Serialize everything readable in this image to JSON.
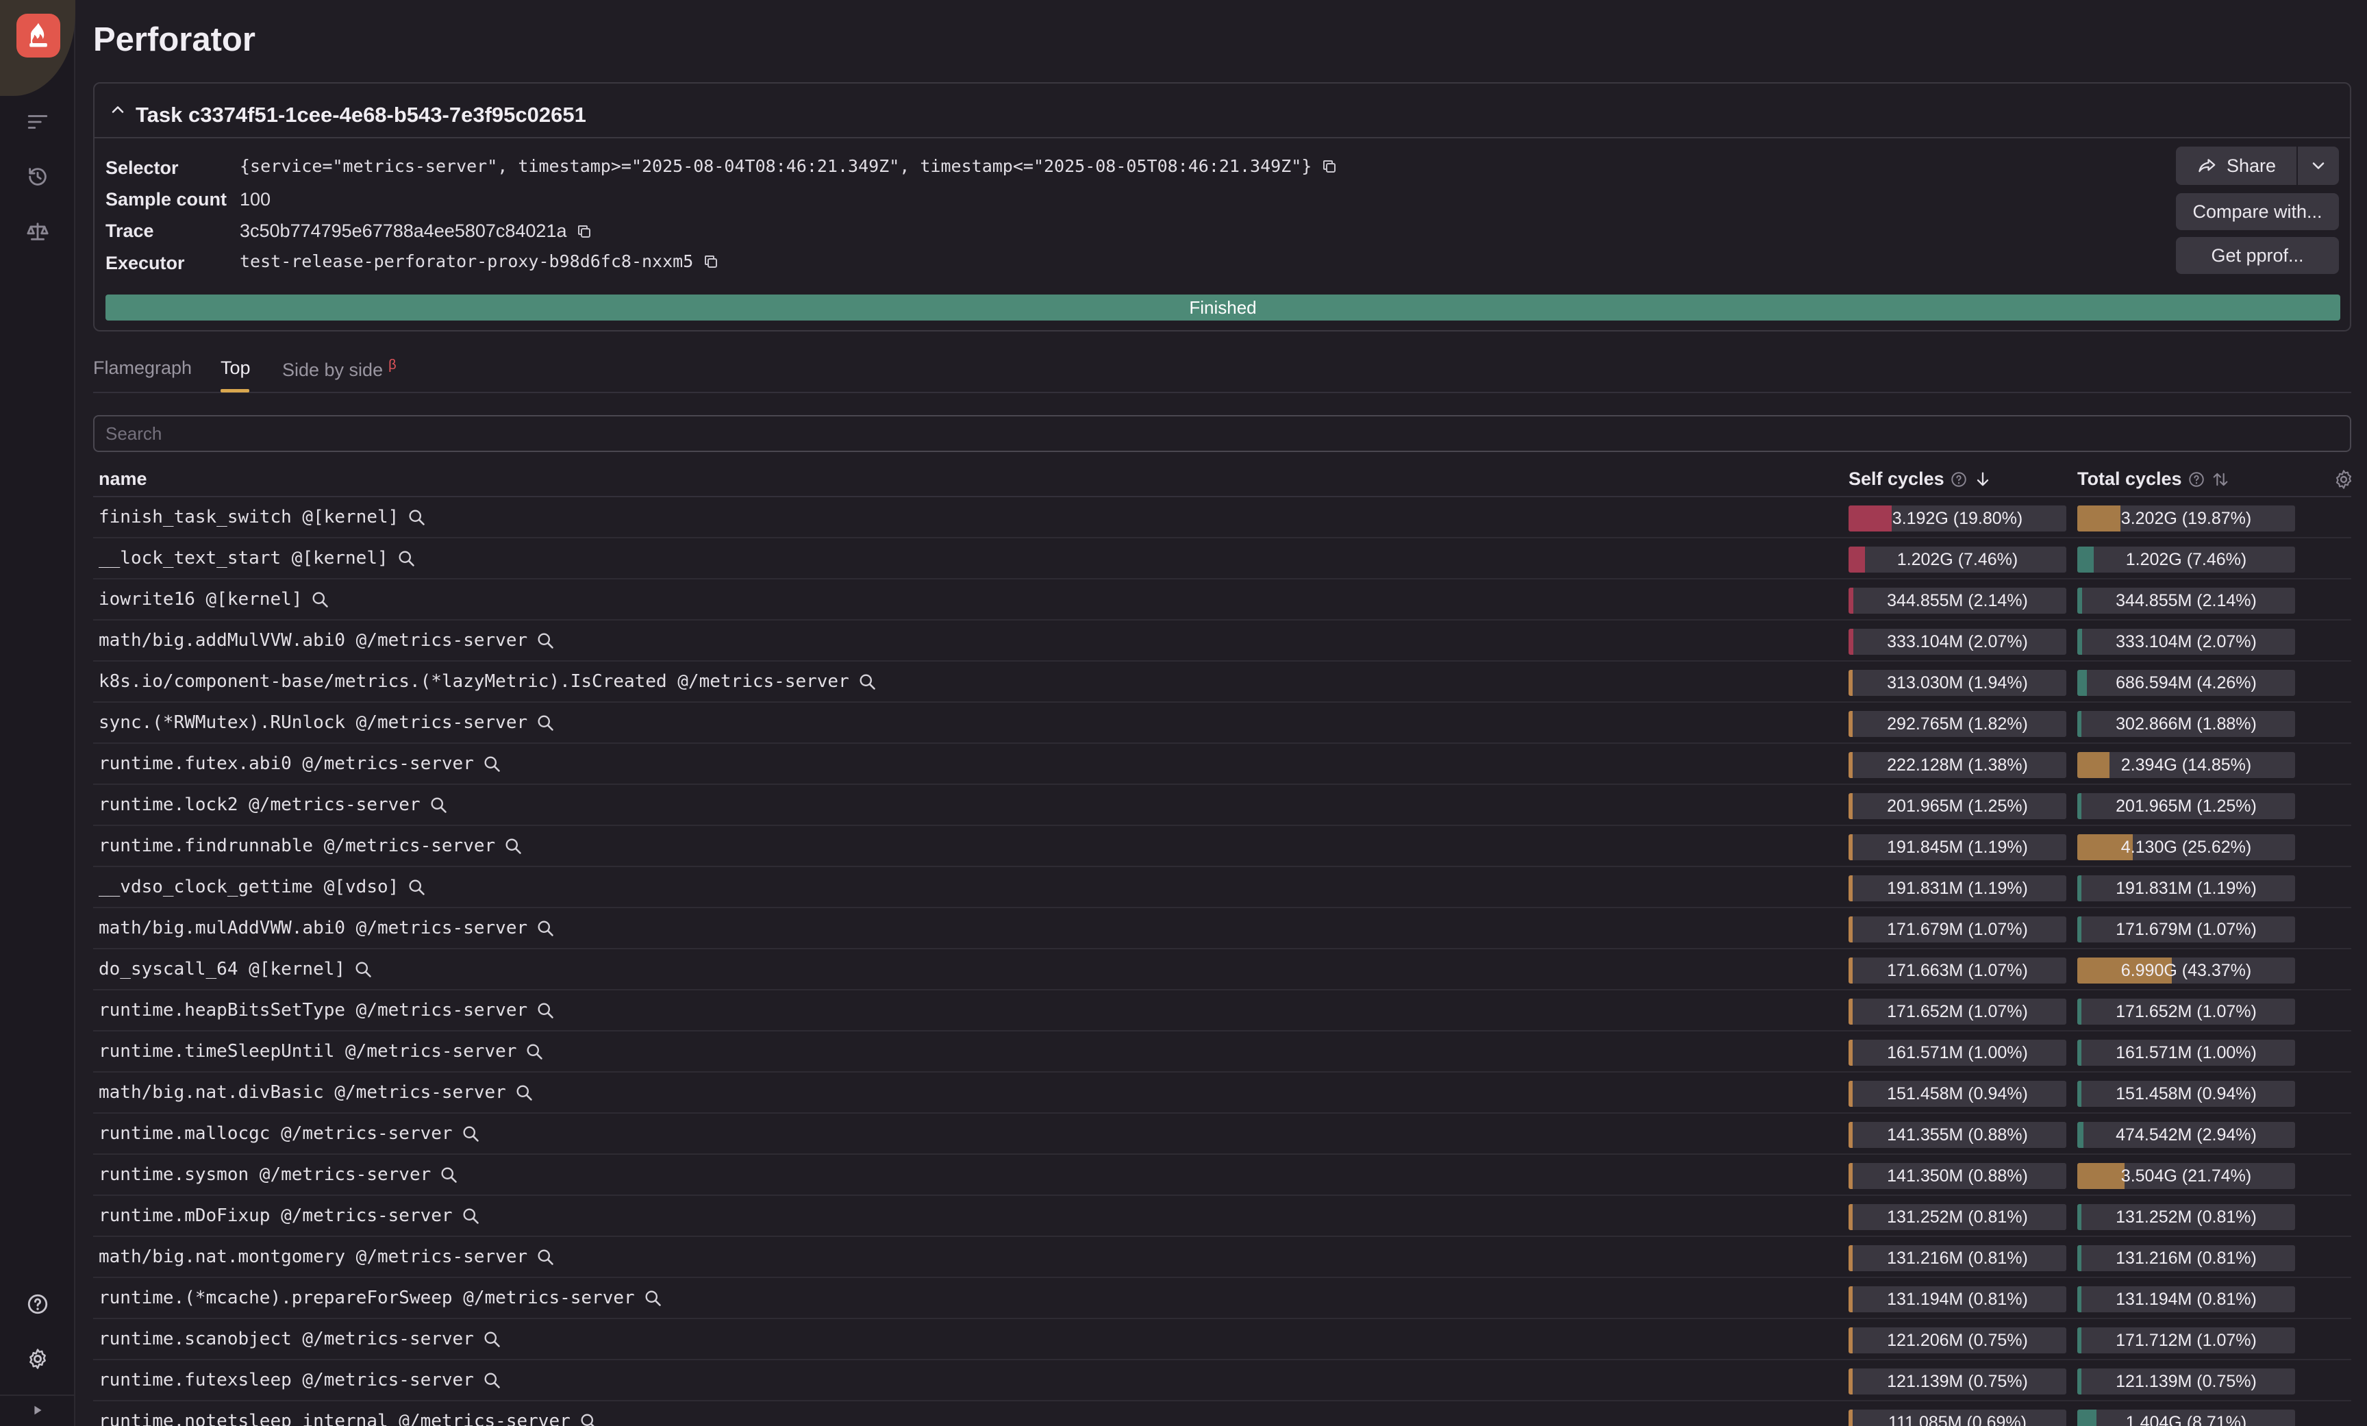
{
  "app": {
    "title": "Perforator"
  },
  "sidebar": {
    "icons": [
      "flame-logo-icon",
      "list-icon",
      "history-icon",
      "balance-icon",
      "help-icon",
      "settings-icon",
      "expand-icon"
    ]
  },
  "task": {
    "title": "Task c3374f51-1cee-4e68-b543-7e3f95c02651",
    "selector_label": "Selector",
    "selector_value": "{service=\"metrics-server\", timestamp>=\"2025-08-04T08:46:21.349Z\", timestamp<=\"2025-08-05T08:46:21.349Z\"}",
    "sample_count_label": "Sample count",
    "sample_count_value": "100",
    "trace_label": "Trace",
    "trace_value": "3c50b774795e67788a4ee5807c84021a",
    "executor_label": "Executor",
    "executor_value": "test-release-perforator-proxy-b98d6fc8-nxxm5",
    "status": "Finished",
    "progress": 1.0,
    "share_label": "Share",
    "compare_label": "Compare with...",
    "pprof_label": "Get pprof..."
  },
  "tabs": [
    {
      "label": "Flamegraph",
      "active": false
    },
    {
      "label": "Top",
      "active": true
    },
    {
      "label": "Side by side",
      "active": false,
      "badge": "β"
    }
  ],
  "search": {
    "placeholder": "Search",
    "value": ""
  },
  "table": {
    "headers": {
      "name": "name",
      "self": "Self cycles",
      "total": "Total cycles"
    },
    "rows": [
      {
        "name": "finish_task_switch @[kernel]",
        "self": "3.192G (19.80%)",
        "self_pct": 19.8,
        "total": "3.202G (19.87%)",
        "total_pct": 19.87
      },
      {
        "name": "__lock_text_start @[kernel]",
        "self": "1.202G (7.46%)",
        "self_pct": 7.46,
        "total": "1.202G (7.46%)",
        "total_pct": 7.46
      },
      {
        "name": "iowrite16 @[kernel]",
        "self": "344.855M (2.14%)",
        "self_pct": 2.14,
        "total": "344.855M (2.14%)",
        "total_pct": 2.14
      },
      {
        "name": "math/big.addMulVVW.abi0 @/metrics-server",
        "self": "333.104M (2.07%)",
        "self_pct": 2.07,
        "total": "333.104M (2.07%)",
        "total_pct": 2.07
      },
      {
        "name": "k8s.io/component-base/metrics.(*lazyMetric).IsCreated @/metrics-server",
        "self": "313.030M (1.94%)",
        "self_pct": 1.94,
        "total": "686.594M (4.26%)",
        "total_pct": 4.26
      },
      {
        "name": "sync.(*RWMutex).RUnlock @/metrics-server",
        "self": "292.765M (1.82%)",
        "self_pct": 1.82,
        "total": "302.866M (1.88%)",
        "total_pct": 1.88
      },
      {
        "name": "runtime.futex.abi0 @/metrics-server",
        "self": "222.128M (1.38%)",
        "self_pct": 1.38,
        "total": "2.394G (14.85%)",
        "total_pct": 14.85
      },
      {
        "name": "runtime.lock2 @/metrics-server",
        "self": "201.965M (1.25%)",
        "self_pct": 1.25,
        "total": "201.965M (1.25%)",
        "total_pct": 1.25
      },
      {
        "name": "runtime.findrunnable @/metrics-server",
        "self": "191.845M (1.19%)",
        "self_pct": 1.19,
        "total": "4.130G (25.62%)",
        "total_pct": 25.62
      },
      {
        "name": "__vdso_clock_gettime @[vdso]",
        "self": "191.831M (1.19%)",
        "self_pct": 1.19,
        "total": "191.831M (1.19%)",
        "total_pct": 1.19
      },
      {
        "name": "math/big.mulAddVWW.abi0 @/metrics-server",
        "self": "171.679M (1.07%)",
        "self_pct": 1.07,
        "total": "171.679M (1.07%)",
        "total_pct": 1.07
      },
      {
        "name": "do_syscall_64 @[kernel]",
        "self": "171.663M (1.07%)",
        "self_pct": 1.07,
        "total": "6.990G (43.37%)",
        "total_pct": 43.37
      },
      {
        "name": "runtime.heapBitsSetType @/metrics-server",
        "self": "171.652M (1.07%)",
        "self_pct": 1.07,
        "total": "171.652M (1.07%)",
        "total_pct": 1.07
      },
      {
        "name": "runtime.timeSleepUntil @/metrics-server",
        "self": "161.571M (1.00%)",
        "self_pct": 1.0,
        "total": "161.571M (1.00%)",
        "total_pct": 1.0
      },
      {
        "name": "math/big.nat.divBasic @/metrics-server",
        "self": "151.458M (0.94%)",
        "self_pct": 0.94,
        "total": "151.458M (0.94%)",
        "total_pct": 0.94
      },
      {
        "name": "runtime.mallocgc @/metrics-server",
        "self": "141.355M (0.88%)",
        "self_pct": 0.88,
        "total": "474.542M (2.94%)",
        "total_pct": 2.94
      },
      {
        "name": "runtime.sysmon @/metrics-server",
        "self": "141.350M (0.88%)",
        "self_pct": 0.88,
        "total": "3.504G (21.74%)",
        "total_pct": 21.74
      },
      {
        "name": "runtime.mDoFixup @/metrics-server",
        "self": "131.252M (0.81%)",
        "self_pct": 0.81,
        "total": "131.252M (0.81%)",
        "total_pct": 0.81
      },
      {
        "name": "math/big.nat.montgomery @/metrics-server",
        "self": "131.216M (0.81%)",
        "self_pct": 0.81,
        "total": "131.216M (0.81%)",
        "total_pct": 0.81
      },
      {
        "name": "runtime.(*mcache).prepareForSweep @/metrics-server",
        "self": "131.194M (0.81%)",
        "self_pct": 0.81,
        "total": "131.194M (0.81%)",
        "total_pct": 0.81
      },
      {
        "name": "runtime.scanobject @/metrics-server",
        "self": "121.206M (0.75%)",
        "self_pct": 0.75,
        "total": "171.712M (1.07%)",
        "total_pct": 1.07
      },
      {
        "name": "runtime.futexsleep @/metrics-server",
        "self": "121.139M (0.75%)",
        "self_pct": 0.75,
        "total": "121.139M (0.75%)",
        "total_pct": 0.75
      },
      {
        "name": "runtime.notetsleep_internal @/metrics-server",
        "self": "111.085M (0.69%)",
        "self_pct": 0.69,
        "total": "1.404G (8.71%)",
        "total_pct": 8.71
      }
    ]
  },
  "colors": {
    "self_bar": "#a23a52",
    "self_bar_small": "#b8834c",
    "total_bar_hot": "#a57a47",
    "total_bar_cool": "#3f7a6e",
    "progress": "#4d8a77",
    "tab_underline": "#d9a74f",
    "logo": "#e2574c"
  }
}
